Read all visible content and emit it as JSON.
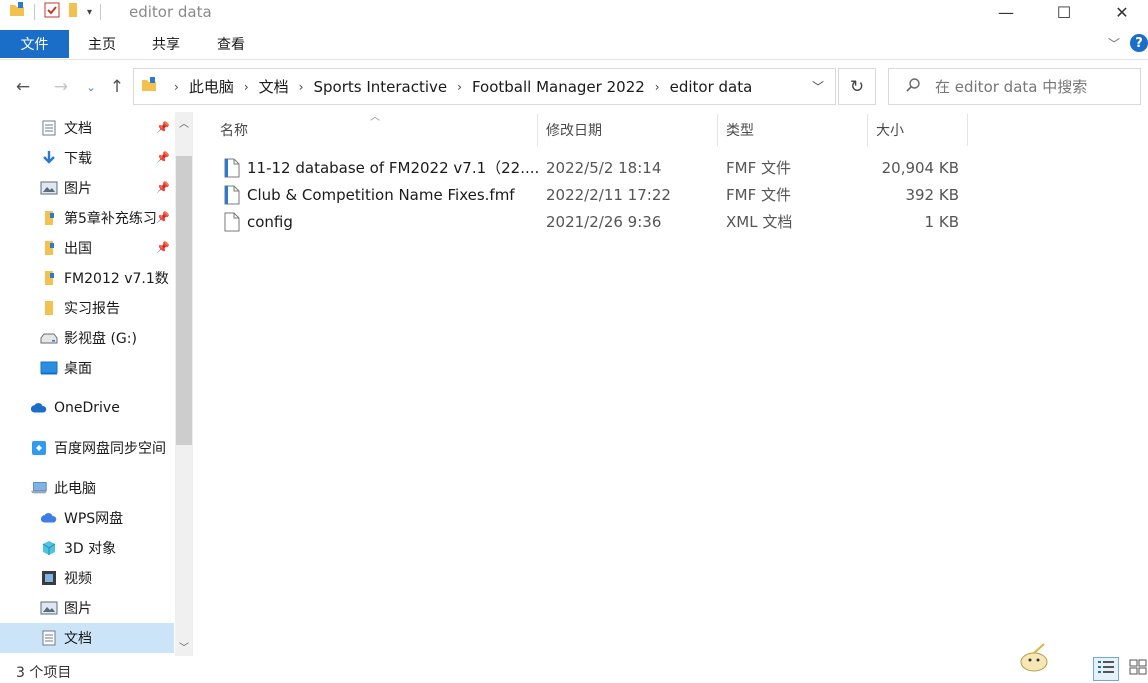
{
  "window": {
    "title": "editor data",
    "minimize_icon": "minimize-icon",
    "maximize_icon": "maximize-icon",
    "close_icon": "close-icon"
  },
  "ribbon": {
    "tabs": [
      {
        "label": "文件",
        "active": true
      },
      {
        "label": "主页"
      },
      {
        "label": "共享"
      },
      {
        "label": "查看"
      }
    ],
    "help_label": "?"
  },
  "address": {
    "breadcrumbs": [
      "此电脑",
      "文档",
      "Sports Interactive",
      "Football Manager 2022",
      "editor data"
    ]
  },
  "search": {
    "placeholder": "在 editor data 中搜索"
  },
  "nav": {
    "items": [
      {
        "label": "文档",
        "icon": "documents-icon",
        "pinned": true
      },
      {
        "label": "下载",
        "icon": "download-icon",
        "pinned": true
      },
      {
        "label": "图片",
        "icon": "pictures-icon",
        "pinned": true
      },
      {
        "label": "第5章补充练习",
        "icon": "folder-icon",
        "pinned": true
      },
      {
        "label": "出国",
        "icon": "folder-icon",
        "pinned": true
      },
      {
        "label": "FM2012 v7.1数",
        "icon": "folder-icon",
        "pinned": false
      },
      {
        "label": "实习报告",
        "icon": "folder-icon",
        "pinned": false
      },
      {
        "label": "影视盘 (G:)",
        "icon": "drive-icon",
        "pinned": false
      },
      {
        "label": "桌面",
        "icon": "desktop-icon",
        "pinned": false
      },
      {
        "label": "OneDrive",
        "icon": "onedrive-icon",
        "pinned": false
      },
      {
        "label": "百度网盘同步空间",
        "icon": "baidu-sync-icon",
        "pinned": false
      },
      {
        "label": "此电脑",
        "icon": "this-pc-icon",
        "pinned": false
      },
      {
        "label": "WPS网盘",
        "icon": "wps-cloud-icon",
        "pinned": false
      },
      {
        "label": "3D 对象",
        "icon": "3d-objects-icon",
        "pinned": false
      },
      {
        "label": "视频",
        "icon": "videos-icon",
        "pinned": false
      },
      {
        "label": "图片",
        "icon": "pictures-icon",
        "pinned": false
      },
      {
        "label": "文档",
        "icon": "documents-icon",
        "pinned": false,
        "selected": true
      }
    ]
  },
  "list": {
    "columns": {
      "name": "名称",
      "date": "修改日期",
      "type": "类型",
      "size": "大小"
    },
    "files": [
      {
        "name": "11-12 database of FM2022 v7.1（22....",
        "date": "2022/5/2 18:14",
        "type": "FMF 文件",
        "size": "20,904 KB",
        "icon": "fmf-file-icon"
      },
      {
        "name": "Club & Competition Name Fixes.fmf",
        "date": "2022/2/11 17:22",
        "type": "FMF 文件",
        "size": "392 KB",
        "icon": "fmf-file-icon"
      },
      {
        "name": "config",
        "date": "2021/2/26 9:36",
        "type": "XML 文档",
        "size": "1 KB",
        "icon": "blank-file-icon"
      }
    ]
  },
  "status": {
    "item_count": "3 个项目"
  },
  "colors": {
    "accent": "#1a6ec7",
    "selection": "#cce4f7",
    "folder": "#f2c14e"
  }
}
